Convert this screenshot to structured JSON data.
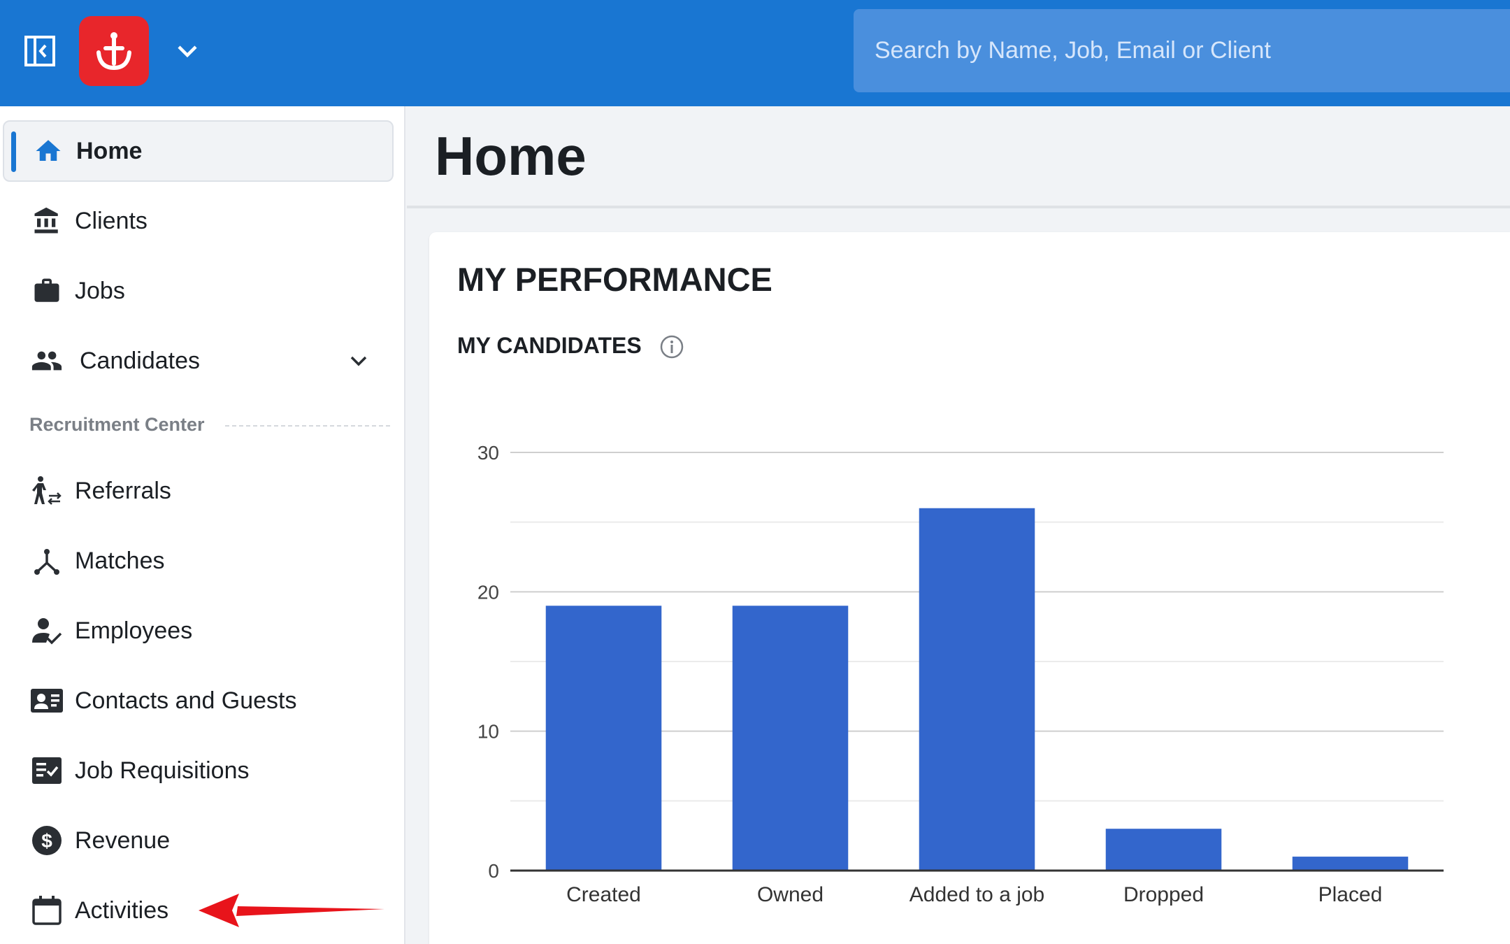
{
  "header": {
    "search_placeholder": "Search by Name, Job, Email or Client",
    "brand_color": "#1976d2",
    "logo_color": "#e8262b"
  },
  "sidebar": {
    "items": [
      {
        "label": "Home",
        "icon": "home-icon",
        "active": true
      },
      {
        "label": "Clients",
        "icon": "bank-icon"
      },
      {
        "label": "Jobs",
        "icon": "briefcase-icon"
      },
      {
        "label": "Candidates",
        "icon": "people-icon",
        "expandable": true
      }
    ],
    "section_label": "Recruitment Center",
    "section_items": [
      {
        "label": "Referrals",
        "icon": "referral-icon"
      },
      {
        "label": "Matches",
        "icon": "merge-icon"
      },
      {
        "label": "Employees",
        "icon": "person-check-icon"
      },
      {
        "label": "Contacts and Guests",
        "icon": "contact-card-icon"
      },
      {
        "label": "Job Requisitions",
        "icon": "checklist-icon"
      },
      {
        "label": "Revenue",
        "icon": "dollar-circle-icon"
      },
      {
        "label": "Activities",
        "icon": "calendar-icon"
      }
    ]
  },
  "main": {
    "title": "Home",
    "card_title": "MY PERFORMANCE",
    "card_subtitle": "MY CANDIDATES"
  },
  "chart_data": {
    "type": "bar",
    "categories": [
      "Created",
      "Owned",
      "Added to a job",
      "Dropped",
      "Placed"
    ],
    "values": [
      19,
      19,
      26,
      3,
      1
    ],
    "yticks": [
      0,
      10,
      20,
      30
    ],
    "ylim": [
      0,
      30
    ],
    "color": "#3366cc",
    "grid": true
  },
  "annotation": {
    "color": "#e8141b",
    "points_to": "Activities"
  }
}
